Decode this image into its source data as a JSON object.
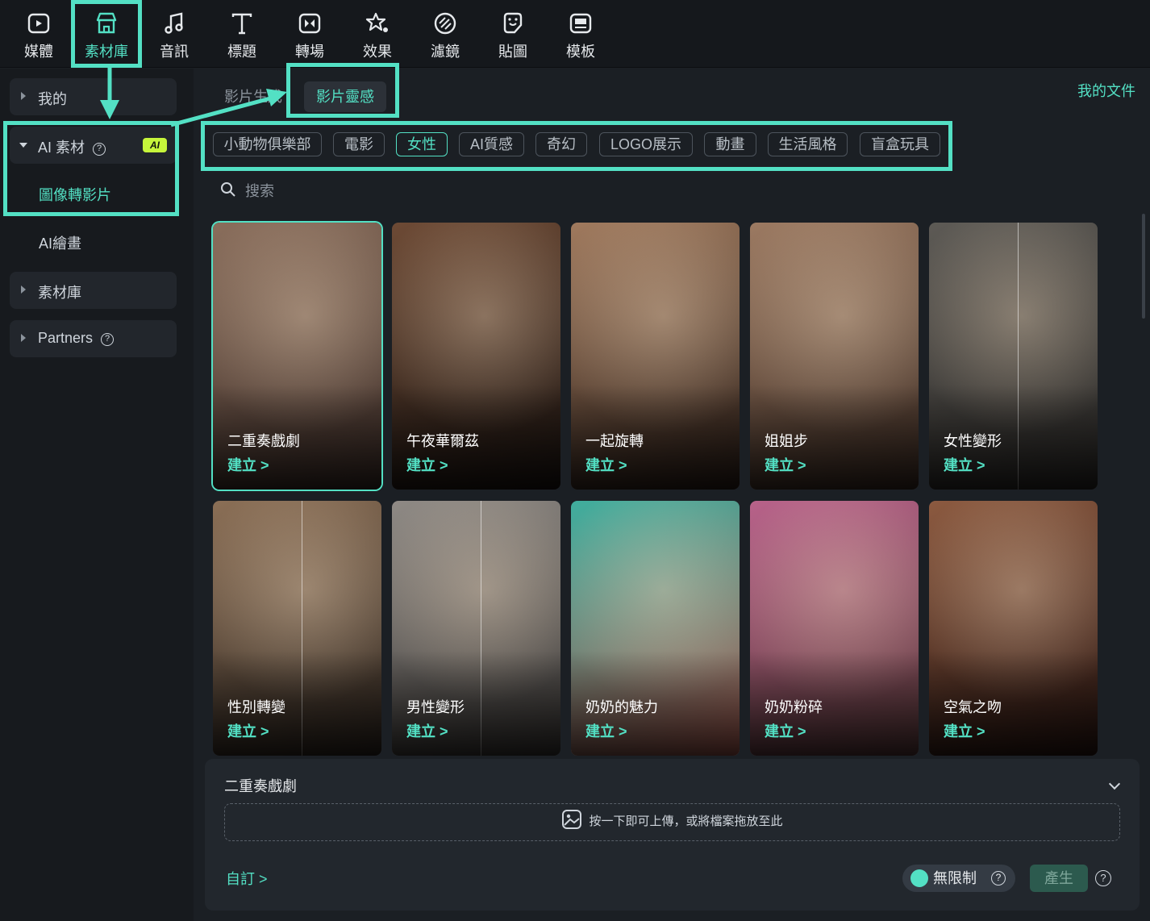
{
  "toolbar": {
    "items": [
      {
        "label": "媒體",
        "icon": "media-icon"
      },
      {
        "label": "素材庫",
        "icon": "store-icon"
      },
      {
        "label": "音訊",
        "icon": "music-note-icon"
      },
      {
        "label": "標題",
        "icon": "title-text-icon"
      },
      {
        "label": "轉場",
        "icon": "transition-icon"
      },
      {
        "label": "效果",
        "icon": "effects-icon"
      },
      {
        "label": "濾鏡",
        "icon": "filter-icon"
      },
      {
        "label": "貼圖",
        "icon": "sticker-icon"
      },
      {
        "label": "模板",
        "icon": "template-icon"
      }
    ],
    "active": "素材庫"
  },
  "sidebar": {
    "mine": "我的",
    "ai_assets": "AI 素材",
    "ai_badge": "AI",
    "image_to_video": "圖像轉影片",
    "ai_painting": "AI繪畫",
    "library": "素材庫",
    "partners": "Partners"
  },
  "tabs": {
    "video_gen": "影片生成",
    "video_inspiration": "影片靈感"
  },
  "my_docs": "我的文件",
  "categories": [
    "小動物俱樂部",
    "電影",
    "女性",
    "AI質感",
    "奇幻",
    "LOGO展示",
    "動畫",
    "生活風格",
    "盲盒玩具"
  ],
  "active_category": "女性",
  "search": {
    "placeholder": "搜索"
  },
  "create_label": "建立 >",
  "cards": [
    {
      "title": "二重奏戲劇",
      "selected": true,
      "colors": [
        "#8a6e5c",
        "#3a2b26"
      ]
    },
    {
      "title": "午夜華爾茲",
      "colors": [
        "#6d4a35",
        "#1a1310"
      ]
    },
    {
      "title": "一起旋轉",
      "colors": [
        "#a07a5e",
        "#2a1d17"
      ]
    },
    {
      "title": "姐姐步",
      "colors": [
        "#9c7a62",
        "#3a2a22"
      ]
    },
    {
      "title": "女性變形",
      "split": true,
      "colors": [
        "#5d5a55",
        "#2a2826"
      ]
    },
    {
      "title": "性別轉變",
      "split": true,
      "colors": [
        "#8b6f56",
        "#2e2620"
      ]
    },
    {
      "title": "男性變形",
      "split": true,
      "colors": [
        "#8f8a85",
        "#3b3836"
      ]
    },
    {
      "title": "奶奶的魅力",
      "colors": [
        "#3fae9e",
        "#a6584e"
      ]
    },
    {
      "title": "奶奶粉碎",
      "colors": [
        "#b8628a",
        "#5a3a3a"
      ]
    },
    {
      "title": "空氣之吻",
      "colors": [
        "#8c5a40",
        "#2a1612"
      ]
    }
  ],
  "panel": {
    "title": "二重奏戲劇",
    "upload_hint": "按一下即可上傳，或將檔案拖放至此",
    "custom": "自訂 >",
    "unlimited": "無限制",
    "generate": "產生"
  },
  "accent": "#53e0c4"
}
